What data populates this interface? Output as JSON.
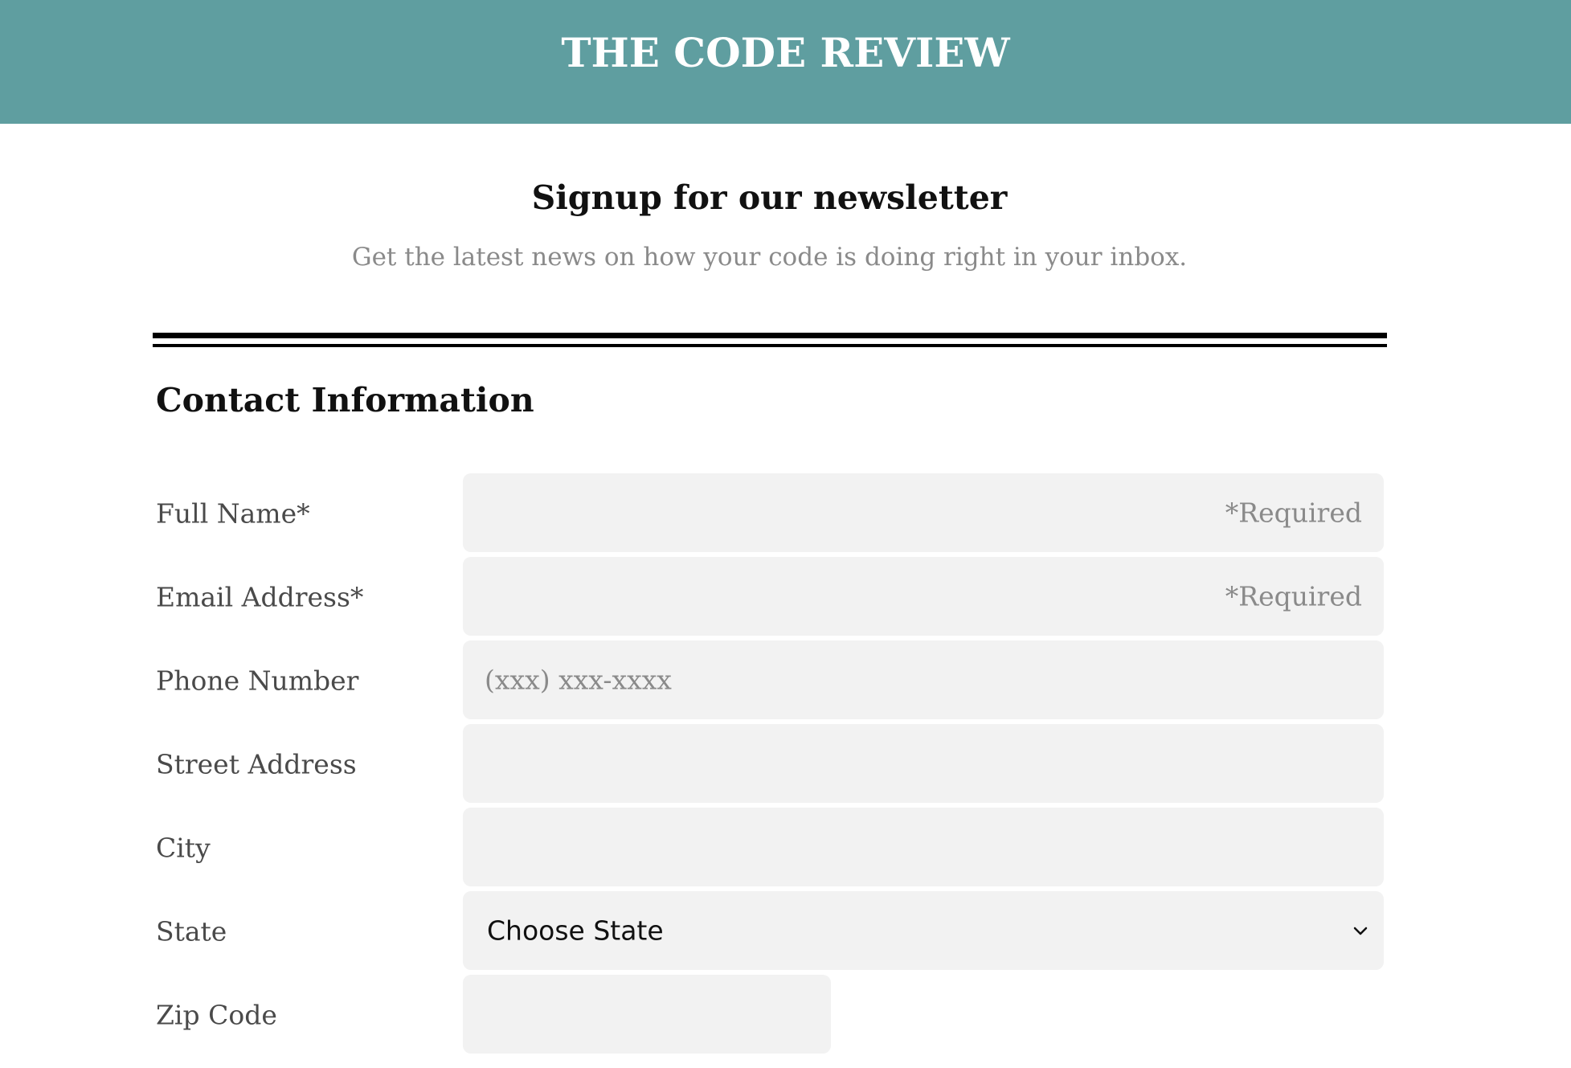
{
  "header": {
    "title": "THE CODE REVIEW",
    "background_color": "#5f9ea0"
  },
  "intro": {
    "title": "Signup for our newsletter",
    "subtitle": "Get the latest news on how your code is doing right in your inbox."
  },
  "section": {
    "title": "Contact Information"
  },
  "form": {
    "full_name": {
      "label": "Full Name*",
      "placeholder": "*Required",
      "value": ""
    },
    "email": {
      "label": "Email Address*",
      "placeholder": "*Required",
      "value": ""
    },
    "phone": {
      "label": "Phone Number",
      "placeholder": "(xxx) xxx-xxxx",
      "value": ""
    },
    "street": {
      "label": "Street Address",
      "value": ""
    },
    "city": {
      "label": "City",
      "value": ""
    },
    "state": {
      "label": "State",
      "selected": "Choose State",
      "icon": "chevron-down-icon"
    },
    "zip": {
      "label": "Zip Code",
      "value": ""
    }
  },
  "colors": {
    "field_background": "#f2f2f2",
    "label_text": "#4a4a4a",
    "placeholder_text": "#8a8a8a"
  }
}
